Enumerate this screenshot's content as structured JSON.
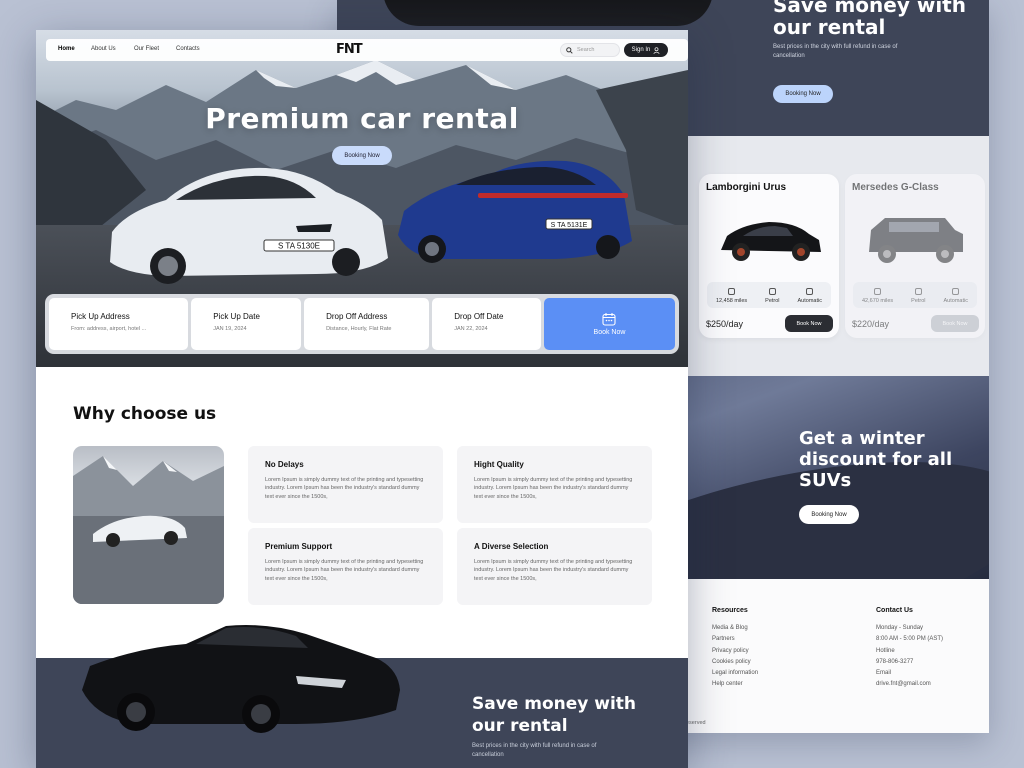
{
  "right_panel": {
    "save": {
      "title": "Save money with our rental",
      "subtitle": "Best prices in the city with full refund in case of cancellation",
      "button": "Booking Now"
    },
    "cars": [
      {
        "name": "Lamborgini Urus",
        "mileage": "12,458 miles",
        "fuel": "Petrol",
        "transmission": "Automatic",
        "price": "$250/day",
        "button": "Book Now"
      },
      {
        "name": "Mersedes G-Class",
        "mileage": "42,670 miles",
        "fuel": "Petrol",
        "transmission": "Automatic",
        "price": "$220/day",
        "button": "Book Now"
      }
    ],
    "winter": {
      "title": "Get a winter discount for all SUVs",
      "button": "Booking Now"
    },
    "footer": {
      "resources_heading": "Resources",
      "resources": [
        "Media & Blog",
        "Partners",
        "Privacy policy",
        "Cookies policy",
        "Legal information",
        "Help center"
      ],
      "contact_heading": "Contact Us",
      "contact": [
        "Monday - Sunday",
        "8:00 AM - 5:00 PM (AST)",
        "Hotline",
        "978-806-3277",
        "Email",
        "drive.fnt@gmail.com"
      ],
      "copyright": "eserved"
    }
  },
  "nav": {
    "items": [
      "Home",
      "About Us",
      "Our Fleet",
      "Contacts"
    ],
    "logo": "FNT",
    "search_placeholder": "Search",
    "signin": "Sign In"
  },
  "hero": {
    "title": "Premium car rental",
    "button": "Booking Now",
    "plate_white": "S TA 5130E",
    "plate_blue": "S TA 5131E"
  },
  "booking": {
    "fields": [
      {
        "label": "Pick Up Address",
        "value": "From: address, airport, hotel ..."
      },
      {
        "label": "Pick Up Date",
        "value": "JAN 19, 2024"
      },
      {
        "label": "Drop Off Address",
        "value": "Distance, Hourly, Flat Rate"
      },
      {
        "label": "Drop Off Date",
        "value": "JAN 22, 2024"
      }
    ],
    "button": "Book Now"
  },
  "why": {
    "title": "Why choose us",
    "features": [
      {
        "title": "No Delays",
        "text": "Lorem Ipsum is simply dummy text of the printing and typesetting industry. Lorem Ipsum has been the industry's standard dummy text ever since the 1500s,"
      },
      {
        "title": "Hight Quality",
        "text": "Lorem Ipsum is simply dummy text of the printing and typesetting industry. Lorem Ipsum has been the industry's standard dummy text ever since the 1500s,"
      },
      {
        "title": "Premium Support",
        "text": "Lorem Ipsum is simply dummy text of the printing and typesetting industry. Lorem Ipsum has been the industry's standard dummy text ever since the 1500s,"
      },
      {
        "title": "A Diverse Selection",
        "text": "Lorem Ipsum is simply dummy text of the printing and typesetting industry. Lorem Ipsum has been the industry's standard dummy text ever since the 1500s,"
      }
    ]
  },
  "save": {
    "title": "Save money with our rental",
    "subtitle": "Best prices in the city with full refund in case of cancellation"
  },
  "colors": {
    "accent": "#5b8ff5",
    "dark_panel": "#3e4558",
    "backdrop": "#b9c1d3"
  }
}
